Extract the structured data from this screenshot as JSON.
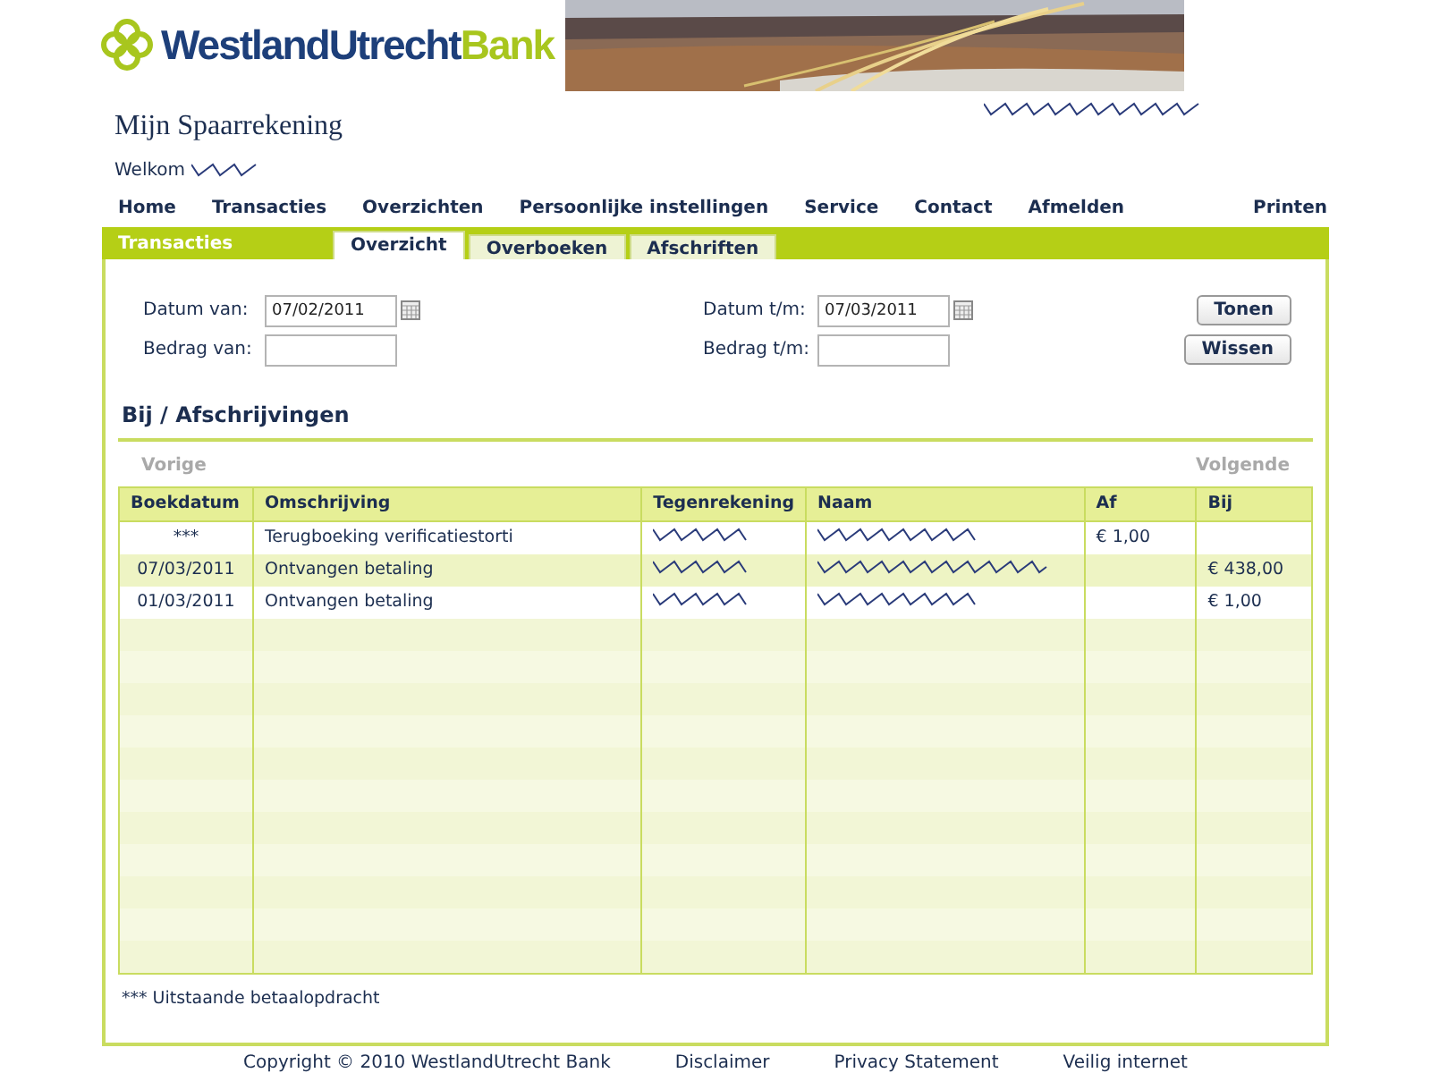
{
  "logo": {
    "name": "WestlandUtrecht",
    "suffix": "Bank"
  },
  "header": {
    "title": "Mijn Spaarrekening",
    "welcome": "Welkom"
  },
  "nav": {
    "items": [
      "Home",
      "Transacties",
      "Overzichten",
      "Persoonlijke instellingen",
      "Service",
      "Contact",
      "Afmelden"
    ],
    "print": "Printen"
  },
  "section": "Transacties",
  "tabs": [
    {
      "label": "Overzicht",
      "selected": true
    },
    {
      "label": "Overboeken",
      "selected": false
    },
    {
      "label": "Afschriften",
      "selected": false
    }
  ],
  "filters": {
    "date_from": {
      "label": "Datum van:",
      "value": "07/02/2011"
    },
    "date_to": {
      "label": "Datum t/m:",
      "value": "07/03/2011"
    },
    "amount_from": {
      "label": "Bedrag van:"
    },
    "amount_to": {
      "label": "Bedrag t/m:"
    },
    "buttons": [
      "Tonen",
      "Wissen"
    ]
  },
  "list": {
    "title": "Bij / Afschrijvingen",
    "previous": "Vorige",
    "next": "Volgende"
  },
  "table": {
    "columns": [
      "Boekdatum",
      "Omschrijving",
      "Tegenrekening",
      "Naam",
      "Af",
      "Bij"
    ],
    "rows": [
      {
        "date": "***",
        "description": "Terugboeking verificatiestorti",
        "af": "€ 1,00",
        "bij": ""
      },
      {
        "date": "07/03/2011",
        "description": "Ontvangen betaling",
        "af": "",
        "bij": "€ 438,00"
      },
      {
        "date": "01/03/2011",
        "description": "Ontvangen betaling",
        "af": "",
        "bij": "€ 1,00"
      }
    ]
  },
  "footnote": "*** Uitstaande betaalopdracht",
  "footer": [
    "Copyright © 2010 WestlandUtrecht Bank",
    "Disclaimer",
    "Privacy Statement",
    "Veilig internet"
  ]
}
